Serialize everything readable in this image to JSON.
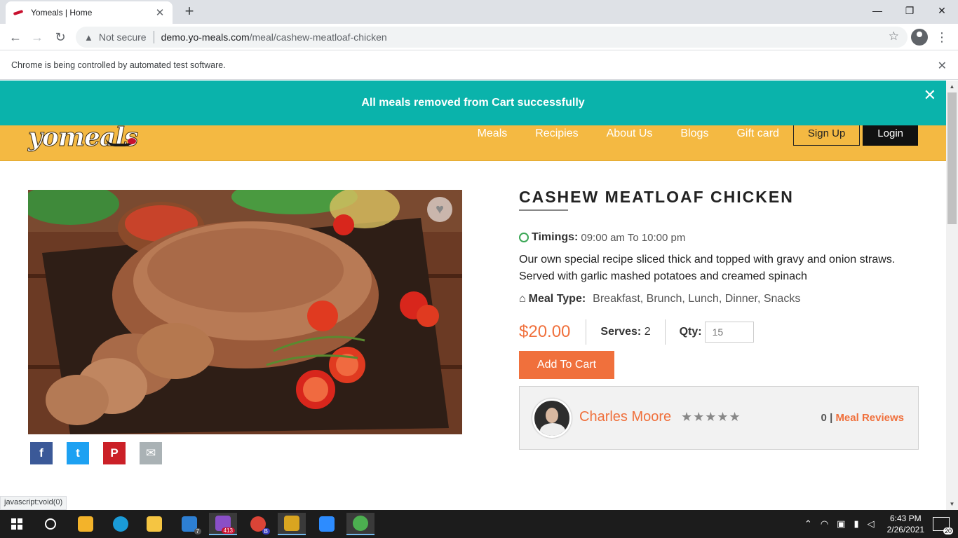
{
  "browser": {
    "tab_title": "Yomeals | Home",
    "security_label": "Not secure",
    "url_host": "demo.yo-meals.com",
    "url_path": "/meal/cashew-meatloaf-chicken",
    "infobar_text": "Chrome is being controlled by automated test software.",
    "status_url": "javascript:void(0)"
  },
  "toast": {
    "message": "All meals removed from Cart successfully",
    "close": "✕"
  },
  "header": {
    "logo_text": "yomeals",
    "nav": [
      "Meals",
      "Recipies",
      "About Us",
      "Blogs",
      "Gift card"
    ],
    "signup": "Sign Up",
    "login": "Login"
  },
  "meal": {
    "title": "CASHEW MEATLOAF CHICKEN",
    "timings_label": "Timings:",
    "timings_value": "09:00 am To 10:00 pm",
    "description": "Our own special recipe sliced thick and topped with gravy and onion straws. Served with garlic mashed potatoes and creamed spinach",
    "meal_type_label": "Meal Type:",
    "meal_type_value": "Breakfast, Brunch, Lunch, Dinner, Snacks",
    "price": "$20.00",
    "serves_label": "Serves:",
    "serves_value": "2",
    "qty_label": "Qty:",
    "qty_placeholder": "15",
    "add_to_cart": "Add To Cart"
  },
  "chef": {
    "name": "Charles Moore",
    "stars": "★★★★★",
    "rating": 0,
    "review_count": "0",
    "review_sep": "|",
    "review_link": "Meal Reviews"
  },
  "share": {
    "facebook": "f",
    "twitter": "t",
    "pinterest": "P",
    "email": "✉"
  },
  "taskbar": {
    "time": "6:43 PM",
    "date": "2/26/2021",
    "mail_badge": "7",
    "app_badge": "413",
    "chrome_b_badge": "B",
    "notification_count": "20"
  },
  "colors": {
    "header_bg": "#f4b942",
    "toast_bg": "#0ab3ab",
    "accent": "#f0703c"
  }
}
